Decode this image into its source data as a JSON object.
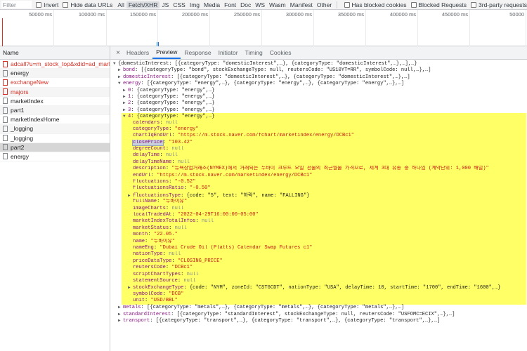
{
  "filter_bar": {
    "placeholder": "Filter",
    "invert": "Invert",
    "hide_data_urls": "Hide data URLs",
    "types": [
      "All",
      "Fetch/XHR",
      "JS",
      "CSS",
      "Img",
      "Media",
      "Font",
      "Doc",
      "WS",
      "Wasm",
      "Manifest",
      "Other"
    ],
    "active_type": "Fetch/XHR",
    "has_blocked_cookies": "Has blocked cookies",
    "blocked_requests": "Blocked Requests",
    "third_party": "3rd-party requests"
  },
  "timeline": {
    "ticks": [
      "50000 ms",
      "100000 ms",
      "150000 ms",
      "200000 ms",
      "250000 ms",
      "300000 ms",
      "350000 ms",
      "400000 ms",
      "450000 ms",
      "50000"
    ]
  },
  "name_panel": {
    "header": "Name",
    "rows": [
      {
        "label": "adcall?u=m_stock_top&xdid=ad_mark",
        "error": true
      },
      {
        "label": "energy",
        "error": false
      },
      {
        "label": "exchangeNew",
        "error": true
      },
      {
        "label": "majors",
        "error": true
      },
      {
        "label": "marketIndex",
        "error": false
      },
      {
        "label": "part1",
        "error": false
      },
      {
        "label": "marketIndexHome",
        "error": false
      },
      {
        "label": "_logging",
        "error": false
      },
      {
        "label": "_logging",
        "error": false
      },
      {
        "label": "part2",
        "error": false,
        "selected": true
      },
      {
        "label": "energy",
        "error": false
      }
    ]
  },
  "tabs": {
    "close": "×",
    "items": [
      "Headers",
      "Preview",
      "Response",
      "Initiator",
      "Timing",
      "Cookies"
    ],
    "active": "Preview"
  },
  "json_lines": [
    {
      "indent": 0,
      "tri": "▼",
      "text": "{domesticInterest: [{categoryType: \"domesticInterest\",…}, {categoryType: \"domesticInterest\",…},…],…}"
    },
    {
      "indent": 1,
      "tri": "▶",
      "key": "bond",
      "text": "[{categoryType: \"bond\", stockExchangeType: null, reutersCode: \"US10YT=RR\", symbolCode: null,…},…]"
    },
    {
      "indent": 1,
      "tri": "▶",
      "key": "domesticInterest",
      "text": "[{categoryType: \"domesticInterest\",…}, {categoryType: \"domesticInterest\",…},…]"
    },
    {
      "indent": 1,
      "tri": "▼",
      "key": "energy",
      "text": "[{categoryType: \"energy\",…}, {categoryType: \"energy\",…}, {categoryType: \"energy\",…},…]"
    },
    {
      "indent": 2,
      "tri": "▶",
      "key": "0",
      "text": "{categoryType: \"energy\",…}"
    },
    {
      "indent": 2,
      "tri": "▶",
      "key": "1",
      "text": "{categoryType: \"energy\",…}"
    },
    {
      "indent": 2,
      "tri": "▶",
      "key": "2",
      "text": "{categoryType: \"energy\",…}"
    },
    {
      "indent": 2,
      "tri": "▶",
      "key": "3",
      "text": "{categoryType: \"energy\",…}"
    },
    {
      "indent": 2,
      "tri": "▼",
      "key": "4",
      "text": "{categoryType: \"energy\",…}"
    },
    {
      "indent": 3,
      "key": "calendars",
      "val": "null",
      "type": "null"
    },
    {
      "indent": 3,
      "key": "categoryType",
      "val": "\"energy\"",
      "type": "str"
    },
    {
      "indent": 3,
      "key": "chartIqEndUrl",
      "val": "\"https://m.stock.naver.com/fchart/marketindex/energy/DCBc1\"",
      "type": "str"
    },
    {
      "indent": 3,
      "key": "closePrice",
      "val": "\"103.42\"",
      "type": "str",
      "highlight": true
    },
    {
      "indent": 3,
      "key": "degreeCount",
      "val": "null",
      "type": "null"
    },
    {
      "indent": 3,
      "key": "delayTime",
      "val": "null",
      "type": "null"
    },
    {
      "indent": 3,
      "key": "delayTimeName",
      "val": "null",
      "type": "null"
    },
    {
      "indent": 3,
      "key": "description",
      "val": "\"뉴욕상업거래소(NYMEX)에서 거래되는 두바이 크루드 오일 선물의 최근월물 가격으로, 세계 3대 유종 중 하나임 (계약단위: 1,000 배럴)\"",
      "type": "str"
    },
    {
      "indent": 3,
      "key": "endUrl",
      "val": "\"https://m.stock.naver.com/marketindex/energy/DCBc1\"",
      "type": "str"
    },
    {
      "indent": 3,
      "key": "fluctuations",
      "val": "\"-0.52\"",
      "type": "str"
    },
    {
      "indent": 3,
      "key": "fluctuationsRatio",
      "val": "\"-0.50\"",
      "type": "str"
    },
    {
      "indent": 3,
      "tri": "▶",
      "key": "fluctuationsType",
      "text": "{code: \"5\", text: \"하락\", name: \"FALLING\"}"
    },
    {
      "indent": 3,
      "key": "fullName",
      "val": "\"두바이유\"",
      "type": "str"
    },
    {
      "indent": 3,
      "key": "imageCharts",
      "val": "null",
      "type": "null"
    },
    {
      "indent": 3,
      "key": "localTradedAt",
      "val": "\"2022-04-29T16:00:00-05:00\"",
      "type": "str"
    },
    {
      "indent": 3,
      "key": "marketIndexTotalInfos",
      "val": "null",
      "type": "null"
    },
    {
      "indent": 3,
      "key": "marketStatus",
      "val": "null",
      "type": "null"
    },
    {
      "indent": 3,
      "key": "month",
      "val": "\"22.05.\"",
      "type": "str"
    },
    {
      "indent": 3,
      "key": "name",
      "val": "\"두바이유\"",
      "type": "str"
    },
    {
      "indent": 3,
      "key": "nameEng",
      "val": "\"Dubai Crude Oil (Platts) Calendar Swap Futures c1\"",
      "type": "str"
    },
    {
      "indent": 3,
      "key": "nationType",
      "val": "null",
      "type": "null"
    },
    {
      "indent": 3,
      "key": "priceDataType",
      "val": "\"CLOSING_PRICE\"",
      "type": "str"
    },
    {
      "indent": 3,
      "key": "reutersCode",
      "val": "\"DCBc1\"",
      "type": "str"
    },
    {
      "indent": 3,
      "key": "scriptChartTypes",
      "val": "null",
      "type": "null"
    },
    {
      "indent": 3,
      "key": "statementSource",
      "val": "null",
      "type": "null"
    },
    {
      "indent": 3,
      "tri": "▶",
      "key": "stockExchangeType",
      "text": "{code: \"NYM\", zoneId: \"CST6CDT\", nationType: \"USA\", delayTime: 10, startTime: \"1700\", endTime: \"1600\",…}"
    },
    {
      "indent": 3,
      "key": "symbolCode",
      "val": "\"DCB\"",
      "type": "str"
    },
    {
      "indent": 3,
      "key": "unit",
      "val": "\"USD/BBL\"",
      "type": "str"
    },
    {
      "indent": 1,
      "tri": "▶",
      "key": "metals",
      "text": "[{categoryType: \"metals\",…}, {categoryType: \"metals\",…}, {categoryType: \"metals\",…},…]"
    },
    {
      "indent": 1,
      "tri": "▶",
      "key": "standardInterest",
      "text": "[{categoryType: \"standardInterest\", stockExchangeType: null, reutersCode: \"USFOMC=ECIX\",…},…]"
    },
    {
      "indent": 1,
      "tri": "▶",
      "key": "transport",
      "text": "[{categoryType: \"transport\",…}, {categoryType: \"transport\",…}, {categoryType: \"transport\",…},…]"
    }
  ]
}
